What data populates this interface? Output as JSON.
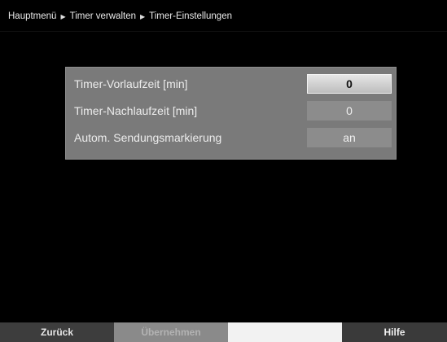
{
  "breadcrumb": {
    "items": [
      "Hauptmenü",
      "Timer verwalten",
      "Timer-Einstellungen"
    ],
    "separator": "▶"
  },
  "settings": {
    "rows": [
      {
        "label": "Timer-Vorlaufzeit [min]",
        "value": "0"
      },
      {
        "label": "Timer-Nachlaufzeit [min]",
        "value": "0"
      },
      {
        "label": "Autom. Sendungsmarkierung",
        "value": "an"
      }
    ]
  },
  "footer": {
    "red": "Zurück",
    "green": "Übernehmen",
    "yellow": "",
    "blue": "Hilfe"
  }
}
